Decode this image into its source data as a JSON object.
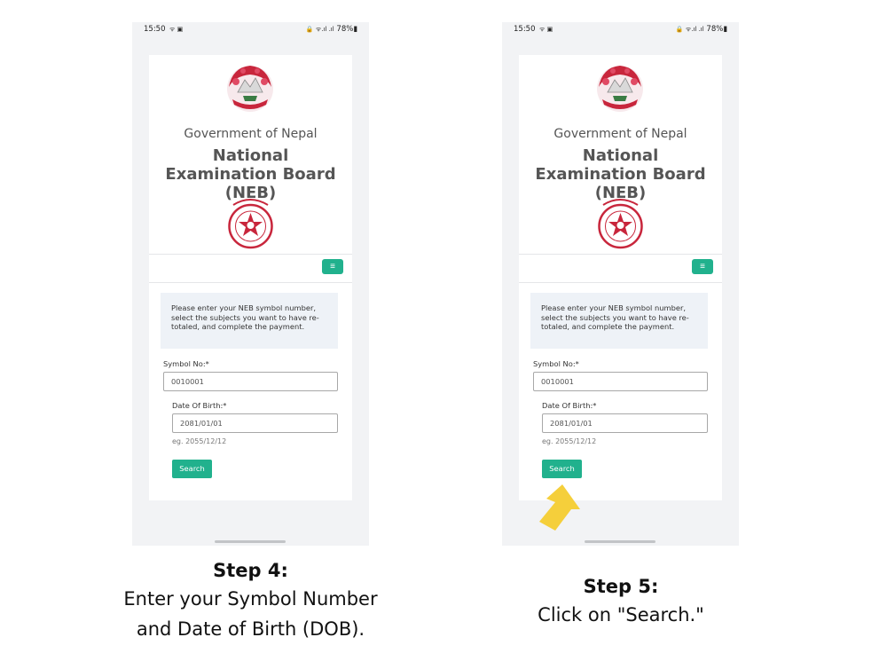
{
  "phones": [
    {
      "status": {
        "time": "15:50",
        "left_icons": "ᯤ ▣",
        "right_icons": "🔒 ᯤ.ıl .ıl",
        "battery": "78%"
      },
      "header": {
        "government": "Government of Nepal",
        "board": "National Examination Board (NEB)"
      },
      "menu_icon": "≡",
      "info_text": "Please enter your NEB symbol number, select the subjects you want to have re-totaled, and complete the payment.",
      "form": {
        "symbol_label": "Symbol No:*",
        "symbol_value": "0010001",
        "dob_label": "Date Of Birth:*",
        "dob_value": "2081/01/01",
        "dob_hint": "eg. 2055/12/12",
        "search_label": "Search"
      }
    },
    {
      "status": {
        "time": "15:50",
        "left_icons": "ᯤ ▣",
        "right_icons": "🔒 ᯤ.ıl .ıl",
        "battery": "78%"
      },
      "header": {
        "government": "Government of Nepal",
        "board": "National Examination Board (NEB)"
      },
      "menu_icon": "≡",
      "info_text": "Please enter your NEB symbol number, select the subjects you want to have re-totaled, and complete the payment.",
      "form": {
        "symbol_label": "Symbol No:*",
        "symbol_value": "0010001",
        "dob_label": "Date Of Birth:*",
        "dob_value": "2081/01/01",
        "dob_hint": "eg. 2055/12/12",
        "search_label": "Search"
      }
    }
  ],
  "captions": [
    {
      "step": "Step 4:",
      "line1": "Enter your Symbol Number",
      "line2": "and Date of Birth (DOB)."
    },
    {
      "step": "Step 5:",
      "line1": "Click on \"Search.\""
    }
  ],
  "colors": {
    "accent": "#21b18d",
    "emblem_red": "#c8263c",
    "arrow": "#f5cf3b"
  },
  "icons": [
    "menu-icon",
    "nepal-emblem-icon",
    "neb-seal-icon",
    "pointer-arrow-icon",
    "battery-icon",
    "signal-icon"
  ]
}
